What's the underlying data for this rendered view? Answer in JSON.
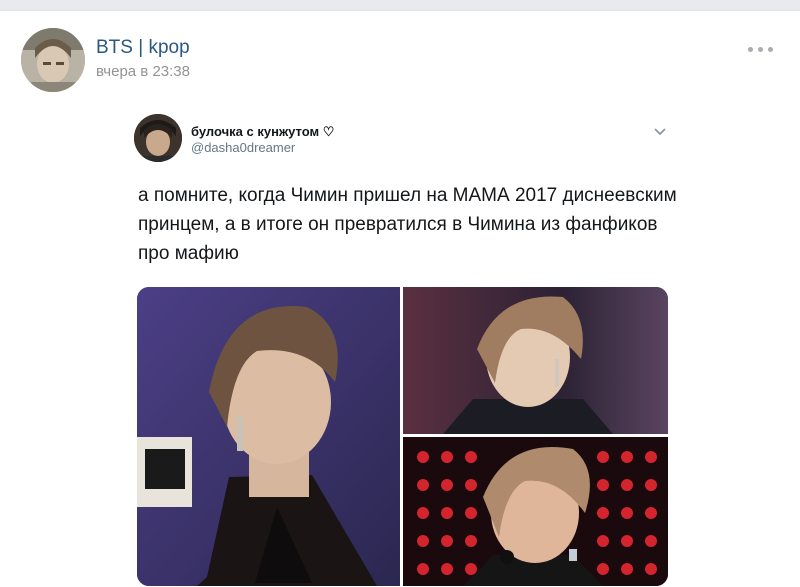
{
  "post": {
    "group_name": "BTS | kpop",
    "time": "вчера в 23:38",
    "more_icon": "more-dots-icon"
  },
  "tweet": {
    "name": "булочка с кунжутом ♡",
    "handle": "@dasha0dreamer",
    "text": "а помните, когда Чимин пришел на МАМА 2017 диснеевским принцем, а в итоге он превратился в Чимина из фанфиков про мафию",
    "menu_icon": "chevron-down-icon"
  },
  "gallery": {
    "photo_count": 3
  },
  "colors": {
    "link": "#2a5885",
    "muted": "#939393",
    "text": "#14171a"
  }
}
